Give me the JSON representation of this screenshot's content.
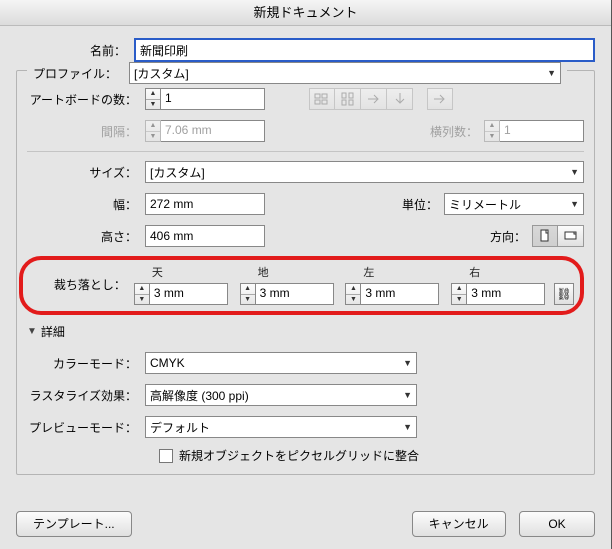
{
  "title": "新規ドキュメント",
  "name": {
    "label": "名前：",
    "value": "新聞印刷"
  },
  "profile": {
    "label": "プロファイル：",
    "value": "[カスタム]"
  },
  "artboards": {
    "count_label": "アートボードの数：",
    "count": "1",
    "spacing_label": "間隔：",
    "spacing": "7.06 mm",
    "cols_label": "横列数：",
    "cols": "1"
  },
  "size": {
    "label": "サイズ：",
    "value": "[カスタム]"
  },
  "width": {
    "label": "幅：",
    "value": "272 mm"
  },
  "height": {
    "label": "高さ：",
    "value": "406 mm"
  },
  "units": {
    "label": "単位：",
    "value": "ミリメートル"
  },
  "orientation": {
    "label": "方向："
  },
  "bleed": {
    "label": "裁ち落とし：",
    "top_label": "天",
    "top": "3 mm",
    "bottom_label": "地",
    "bottom": "3 mm",
    "left_label": "左",
    "left": "3 mm",
    "right_label": "右",
    "right": "3 mm"
  },
  "advanced": {
    "title": "詳細",
    "colormode_label": "カラーモード：",
    "colormode": "CMYK",
    "raster_label": "ラスタライズ効果：",
    "raster": "高解像度 (300 ppi)",
    "preview_label": "プレビューモード：",
    "preview": "デフォルト",
    "pixelgrid": "新規オブジェクトをピクセルグリッドに整合"
  },
  "footer": {
    "template": "テンプレート...",
    "cancel": "キャンセル",
    "ok": "OK"
  }
}
